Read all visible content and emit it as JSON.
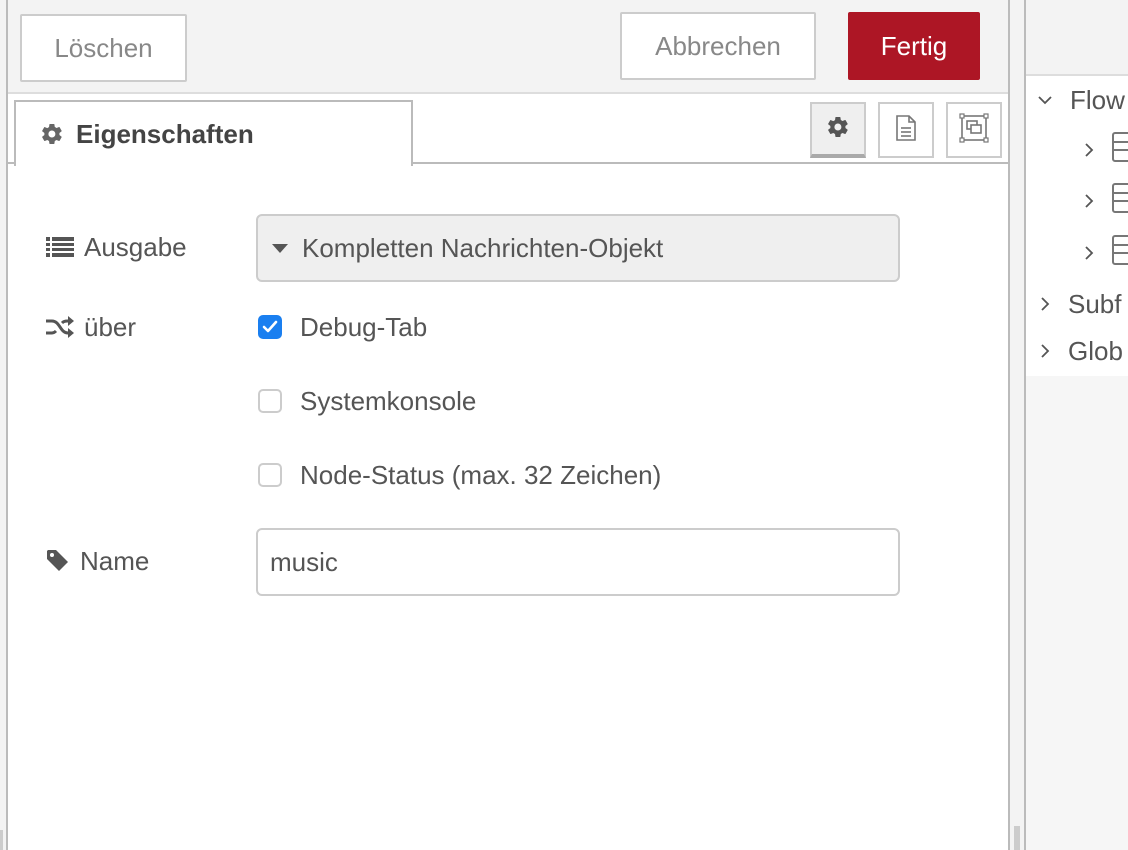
{
  "toolbar": {
    "delete_label": "Löschen",
    "cancel_label": "Abbrechen",
    "done_label": "Fertig",
    "done_color": "#ad1625"
  },
  "tabs": {
    "active_tab_label": "Eigenschaften",
    "tab_buttons": [
      {
        "icon": "gear-icon",
        "active": true
      },
      {
        "icon": "file-text-icon",
        "active": false
      },
      {
        "icon": "window-restore-icon",
        "active": false
      }
    ]
  },
  "form": {
    "output": {
      "label": "Ausgabe",
      "icon": "list-icon",
      "selected_value": "Kompletten Nachrichten-Objekt"
    },
    "to": {
      "label": "über",
      "icon": "random-icon",
      "options": [
        {
          "label": "Debug-Tab",
          "checked": true
        },
        {
          "label": "Systemkonsole",
          "checked": false
        },
        {
          "label": "Node-Status (max. 32 Zeichen)",
          "checked": false
        }
      ]
    },
    "name": {
      "label": "Name",
      "icon": "tag-icon",
      "value": "music",
      "placeholder": ""
    },
    "checkbox_color": "#1a7ff0"
  },
  "sidebar": {
    "tree": [
      {
        "label": "Flow",
        "expanded": true,
        "level": 0
      },
      {
        "label": "",
        "expanded": false,
        "level": 1,
        "icon": "flow-icon"
      },
      {
        "label": "",
        "expanded": false,
        "level": 1,
        "icon": "flow-icon"
      },
      {
        "label": "",
        "expanded": false,
        "level": 1,
        "icon": "flow-icon"
      },
      {
        "label": "Subf",
        "expanded": false,
        "level": 0
      },
      {
        "label": "Glob",
        "expanded": false,
        "level": 0
      }
    ]
  }
}
